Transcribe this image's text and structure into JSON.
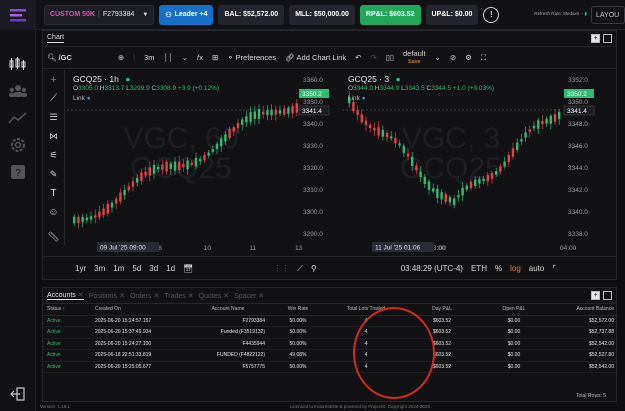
{
  "topbar": {
    "account_button": "CUSTOM 50K",
    "account_id": "F2793384",
    "leader_button": "Leader +4",
    "balance": "BAL: $52,572.00",
    "mll": "MLL: $50,000.00",
    "rp_l": "RP&L: $603.52",
    "up_l": "UP&L: $0.00",
    "refresh_rate": "Refresh Rate: Medium",
    "layout_button": "LAYOU",
    "colors": {
      "accent_pink": "#e24fb4",
      "leader_blue": "#1670c9",
      "rpl_green": "#22a659"
    }
  },
  "chart_panel": {
    "tab": "Chart",
    "toolbar": {
      "symbol": "/GC",
      "interval": "3m",
      "preferences": "Preferences",
      "add_chart_link": "Add Chart Link",
      "layout_name": "default",
      "layout_status": "Save"
    },
    "left_pane": {
      "title": "GCQ25 · 1h",
      "ohlc": {
        "o": "3305.0",
        "h": "3313.7",
        "l": "3299.9",
        "c": "3308.9",
        "change": "+3.9 (+0.12%)"
      },
      "link": "Link",
      "watermark": "GCQ25",
      "watermark_sub": "VGC, 60",
      "price_tag_green": "3350.2",
      "price_tag_crosshair": "3341.4",
      "y_axis": [
        "3360.0",
        "3350.0",
        "3340.0",
        "3330.0",
        "3320.0",
        "3310.0",
        "3300.0",
        "3290.0"
      ],
      "x_axis": [
        "8",
        "10",
        "11",
        "13"
      ],
      "x_highlight": "09 Jul '25",
      "x_highlight_time": "09:00"
    },
    "right_pane": {
      "title": "GCQ25 · 3",
      "ohlc": {
        "o": "3344.0",
        "h": "3344.9",
        "l": "3343.5",
        "c": "3344.5",
        "change": "+1.0 (+0.03%)"
      },
      "link": "Link",
      "watermark": "GCQ25",
      "watermark_sub": "VGC, 3",
      "price_tag_green": "3350.2",
      "price_tag_crosshair": "3341.4",
      "y_axis": [
        "3352.0",
        "3350.0",
        "3348.0",
        "3346.0",
        "3344.0",
        "3342.0",
        "3340.0",
        "3338.0"
      ],
      "x_axis": [
        "03:00",
        "04:00"
      ],
      "x_highlight": "11 Jul '25",
      "x_highlight_time": "01:06",
      "x_highlight_tail": ":00"
    },
    "bottom_toolbar": {
      "ranges": [
        "1yr",
        "3m",
        "1m",
        "5d",
        "3d",
        "1d"
      ],
      "clock": "03:48:29 (UTC-4)",
      "session": "ETH",
      "percent": "%",
      "log": "log",
      "auto": "auto"
    }
  },
  "accounts_panel": {
    "tabs": [
      "Accounts",
      "Positions",
      "Orders",
      "Trades",
      "Quotes",
      "Spacer"
    ],
    "columns": [
      "Status",
      "Created On",
      "Account Name",
      "Win Rate",
      "Total Lots Traded",
      "Day P&L",
      "Open P&L",
      "Account Balance"
    ],
    "sort_arrow": "↑",
    "rows": [
      {
        "status": "Active",
        "created": "2025-06-20 15:24:57.157",
        "name": "F2793384",
        "win": "50.00%",
        "lots": "4",
        "day": "$603.52",
        "open": "$0.00",
        "balance": "$52,572.00"
      },
      {
        "status": "Active",
        "created": "2025-06-20 15:37:49.934",
        "name": "Funded (F3519132)",
        "win": "50.00%",
        "lots": "4",
        "day": "$603.52",
        "open": "$0.00",
        "balance": "$52,737.88"
      },
      {
        "status": "Active",
        "created": "2025-06-20 15:24:27.100",
        "name": "F4435944",
        "win": "50.00%",
        "lots": "4",
        "day": "$603.52",
        "open": "$0.00",
        "balance": "$52,542.00"
      },
      {
        "status": "Active",
        "created": "2025-06-18 22:51:33.819",
        "name": "FUNDED (F4822122)",
        "win": "49.08%",
        "lots": "4",
        "day": "$603.52",
        "open": "$0.00",
        "balance": "$52,527.80"
      },
      {
        "status": "Active",
        "created": "2025-06-20 15:25:05.677",
        "name": "F5757775",
        "win": "50.00%",
        "lots": "4",
        "day": "$603.52",
        "open": "$0.00",
        "balance": "$52,542.00"
      }
    ],
    "total_rows": "Total Rows: 5"
  },
  "footer": {
    "version": "Version: 1.19.1",
    "license": "Licensed to FuturesElite & powered by ProjectX. Copyright 2024-2025"
  }
}
